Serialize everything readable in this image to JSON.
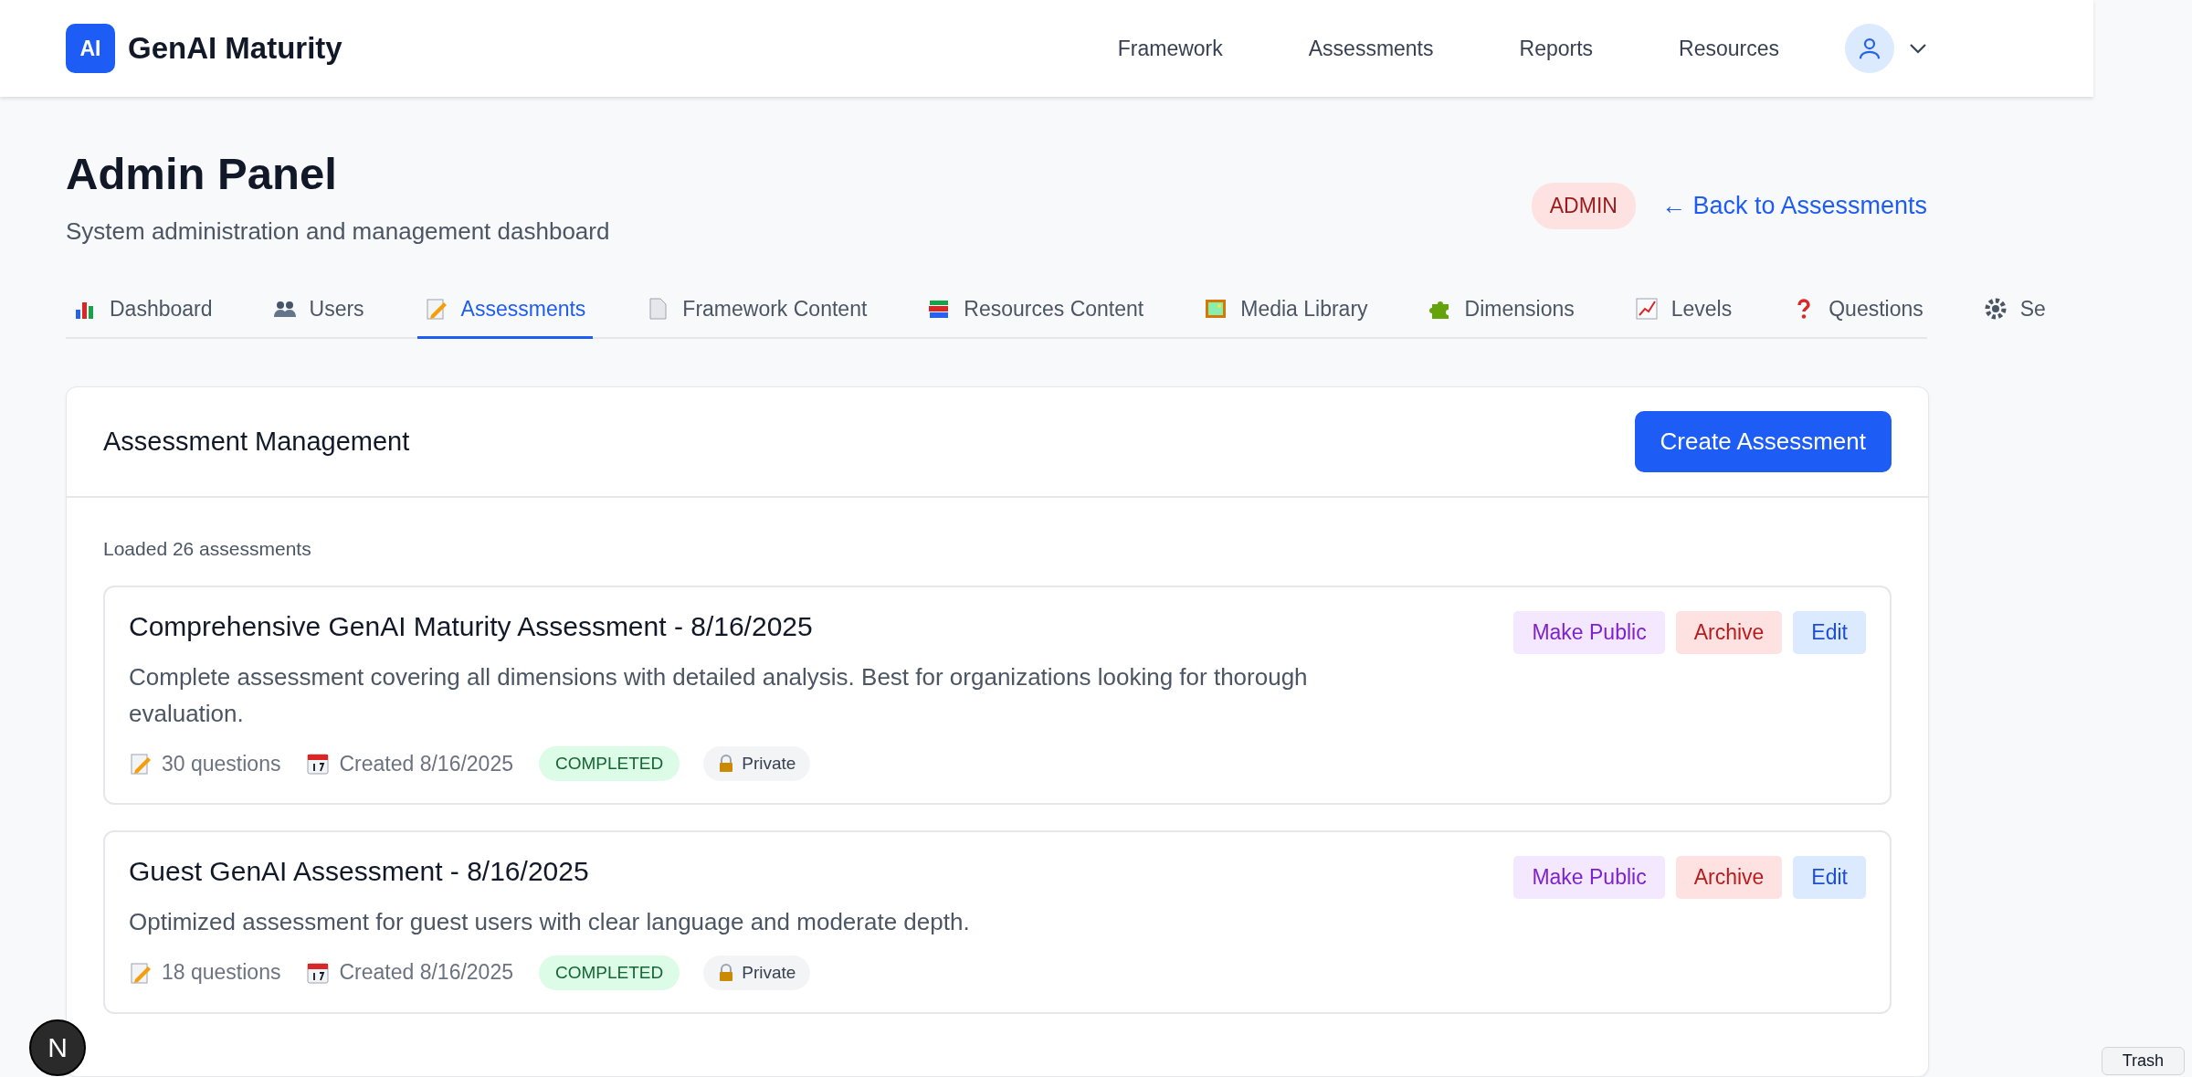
{
  "header": {
    "logo": "AI",
    "brand": "GenAI Maturity",
    "nav": [
      {
        "label": "Framework"
      },
      {
        "label": "Assessments"
      },
      {
        "label": "Reports"
      },
      {
        "label": "Resources"
      }
    ]
  },
  "page": {
    "title": "Admin Panel",
    "subtitle": "System administration and management dashboard",
    "role_badge": "ADMIN",
    "back_link": "← Back to Assessments"
  },
  "tabs": [
    {
      "label": "Dashboard",
      "selected": false
    },
    {
      "label": "Users",
      "selected": false
    },
    {
      "label": "Assessments",
      "selected": true
    },
    {
      "label": "Framework Content",
      "selected": false
    },
    {
      "label": "Resources Content",
      "selected": false
    },
    {
      "label": "Media Library",
      "selected": false
    },
    {
      "label": "Dimensions",
      "selected": false
    },
    {
      "label": "Levels",
      "selected": false
    },
    {
      "label": "Questions",
      "selected": false
    },
    {
      "label": "Se",
      "selected": false
    }
  ],
  "panel": {
    "title": "Assessment Management",
    "create_button": "Create Assessment",
    "loaded_text": "Loaded 26 assessments",
    "assessments": [
      {
        "title": "Comprehensive GenAI Maturity Assessment - 8/16/2025",
        "description": "Complete assessment covering all dimensions with detailed analysis. Best for organizations looking for thorough evaluation.",
        "questions": "30 questions",
        "created": "Created 8/16/2025",
        "status": "COMPLETED",
        "visibility": "Private",
        "actions": [
          {
            "label": "Make Public",
            "kind": "publish"
          },
          {
            "label": "Archive",
            "kind": "archive"
          },
          {
            "label": "Edit",
            "kind": "edit"
          }
        ]
      },
      {
        "title": "Guest GenAI Assessment - 8/16/2025",
        "description": "Optimized assessment for guest users with clear language and moderate depth.",
        "questions": "18 questions",
        "created": "Created 8/16/2025",
        "status": "COMPLETED",
        "visibility": "Private",
        "actions": [
          {
            "label": "Make Public",
            "kind": "publish"
          },
          {
            "label": "Archive",
            "kind": "archive"
          },
          {
            "label": "Edit",
            "kind": "edit"
          }
        ]
      }
    ]
  },
  "dev_badge": "N",
  "trash_button": "Trash"
}
